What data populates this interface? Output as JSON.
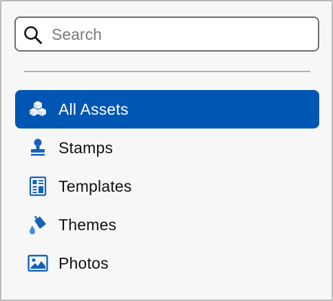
{
  "search": {
    "placeholder": "Search",
    "value": ""
  },
  "sidebar": {
    "accent_color": "#0056b3",
    "icon_color": "#1662b8",
    "items": [
      {
        "label": "All Assets",
        "icon": "boxes-icon",
        "selected": true
      },
      {
        "label": "Stamps",
        "icon": "stamp-icon",
        "selected": false
      },
      {
        "label": "Templates",
        "icon": "template-icon",
        "selected": false
      },
      {
        "label": "Themes",
        "icon": "paint-bucket-icon",
        "selected": false
      },
      {
        "label": "Photos",
        "icon": "photo-icon",
        "selected": false
      }
    ]
  }
}
